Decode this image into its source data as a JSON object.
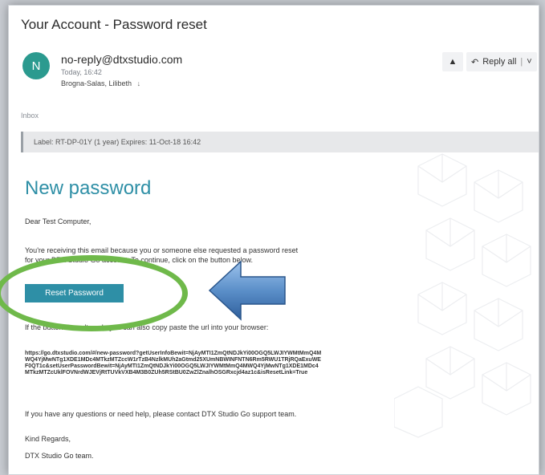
{
  "email": {
    "subject": "Your Account - Password reset",
    "avatar_initial": "N",
    "from": "no-reply@dtxstudio.com",
    "time": "Today, 16:42",
    "to": "Brogna-Salas, Lilibeth",
    "folder": "Inbox",
    "label": "Label: RT-DP-01Y (1 year) Expires: 11-Oct-18 16:42"
  },
  "toolbar": {
    "reply_all_label": "Reply all"
  },
  "body": {
    "heading": "New password",
    "greeting": "Dear Test Computer,",
    "intro_line1": "You're receiving this email because you or someone else requested a password reset",
    "intro_line2": "for your DTX Studio Go account. To continue, click on the button below.",
    "button_label": "Reset Password",
    "fallback_text": "If the button doesn't work, you can also copy paste the url into your browser:",
    "url": "https://go.dtxstudio.com/#/new-password?getUserInfoBewit=NjAyMTI1ZmQtNDJkYi00OGQ5LWJIYWMtMmQ4MWQ4YjMwNTg1XDE1MDc4MTkzMTZccW1rTzB4NzlkMUh2aGtmd25XUmNBWINFNTN6Rm5RWU1TRjRQaExuWEF0QT1c&setUserPasswordBewit=NjAyMTI1ZmQtNDJkYi00OGQ5LWJIYWMtMmQ4MWQ4YjMwNTg1XDE1MDc4MTkzMTZcUklFOVNrdWJEVjRtTUVkVXB4M3B0ZUh5RStBU0ZwZlZnalhOSGRxcjd4az1c&isResetLink=True",
    "help_text": "If you have any questions or need help, please contact DTX Studio Go support team.",
    "regards": "Kind Regards,",
    "signature": "DTX Studio Go team."
  },
  "colors": {
    "accent": "#2e8fa6",
    "avatar": "#2b9a8f",
    "annotation_ring": "#6fb94a",
    "annotation_arrow": "#5b8fc9"
  }
}
